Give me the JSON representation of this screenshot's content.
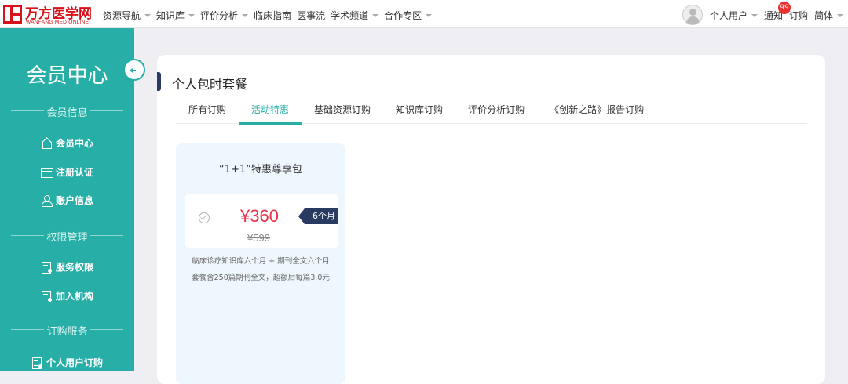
{
  "header": {
    "logo_text": "万方医学网",
    "logo_sub": "WANFANG MED ONLINE",
    "nav": [
      {
        "label": "资源导航",
        "dropdown": true
      },
      {
        "label": "知识库",
        "dropdown": true
      },
      {
        "label": "评价分析",
        "dropdown": true
      },
      {
        "label": "临床指南",
        "dropdown": false
      },
      {
        "label": "医事流",
        "dropdown": false
      },
      {
        "label": "学术频道",
        "dropdown": true
      },
      {
        "label": "合作专区",
        "dropdown": true
      }
    ],
    "user_label": "个人用户",
    "notify_label": "通知",
    "notify_count": "99",
    "order_label": "订购",
    "lang_label": "简体"
  },
  "sidebar": {
    "title": "会员中心",
    "sections": [
      {
        "label": "会员信息",
        "items": [
          {
            "label": "会员中心",
            "icon": "home-icon"
          },
          {
            "label": "注册认证",
            "icon": "id-card-icon"
          },
          {
            "label": "账户信息",
            "icon": "user-icon"
          }
        ]
      },
      {
        "label": "权限管理",
        "items": [
          {
            "label": "服务权限",
            "icon": "permission-doc-icon"
          },
          {
            "label": "加入机构",
            "icon": "institution-doc-icon"
          }
        ]
      },
      {
        "label": "订购服务",
        "items": [
          {
            "label": "个人用户订购",
            "icon": "order-doc-icon"
          }
        ]
      }
    ],
    "accent": "#27aea6"
  },
  "main": {
    "title": "个人包时套餐",
    "tabs": [
      "所有订购",
      "活动特惠",
      "基础资源订购",
      "知识库订购",
      "评价分析订购",
      "《创新之路》报告订购"
    ],
    "active_tab": "活动特惠",
    "package": {
      "name": "“1+1”特惠尊享包",
      "price": "¥360",
      "old_price": "¥599",
      "period": "6个月",
      "desc_line1": "临床诊疗知识库六个月 + 期刊全文六个月",
      "desc_line2": "套餐含250篇期刊全文，超额后每篇3.0元",
      "price_color": "#e8334a"
    }
  }
}
